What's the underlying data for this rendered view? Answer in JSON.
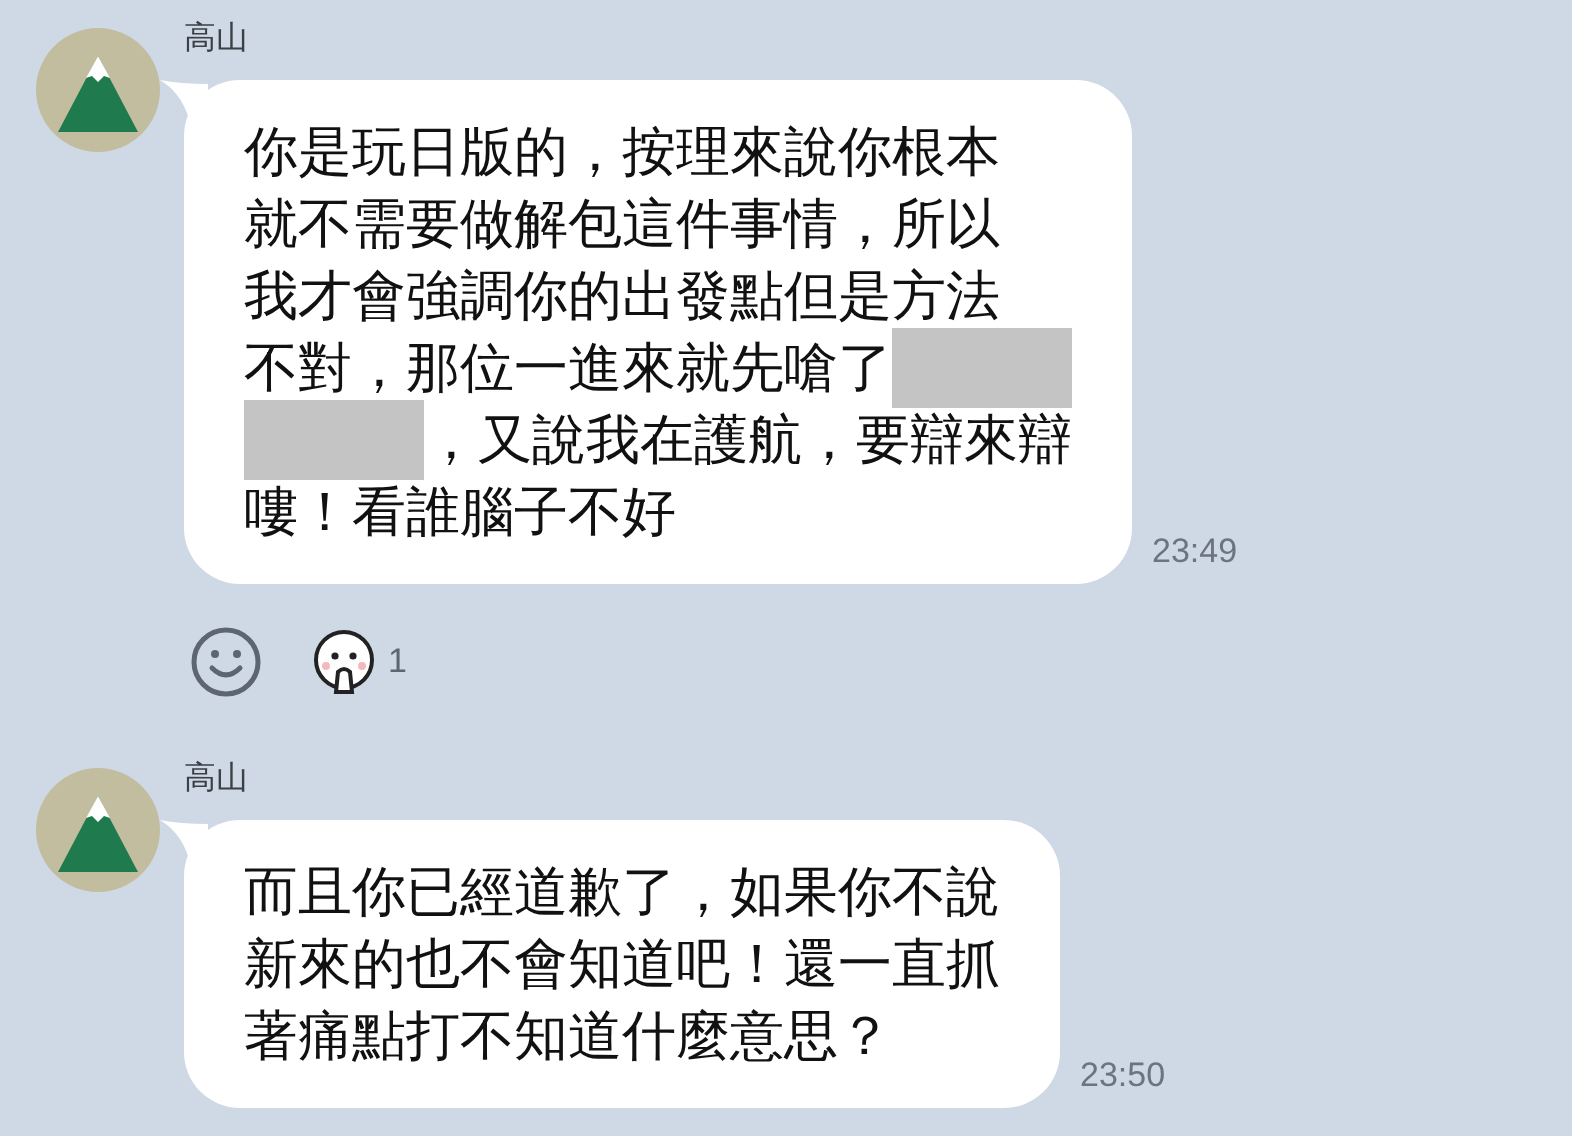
{
  "messages": [
    {
      "sender": "高山",
      "lines": [
        [
          {
            "kind": "text",
            "text": "你是玩日版的，按理來說你根本"
          }
        ],
        [
          {
            "kind": "text",
            "text": "就不需要做解包這件事情，所以"
          }
        ],
        [
          {
            "kind": "text",
            "text": "我才會強調你的出發點但是方法"
          }
        ],
        [
          {
            "kind": "text",
            "text": "不對，那位一進來就先嗆了"
          },
          {
            "kind": "redaction"
          }
        ],
        [
          {
            "kind": "redaction"
          },
          {
            "kind": "text",
            "text": "，又說我在護航，要辯來辯"
          }
        ],
        [
          {
            "kind": "text",
            "text": "嘍！看誰腦子不好"
          }
        ]
      ],
      "time": "23:49",
      "reactions": [
        {
          "count": "1"
        }
      ]
    },
    {
      "sender": "高山",
      "lines": [
        [
          {
            "kind": "text",
            "text": "而且你已經道歉了，如果你不說"
          }
        ],
        [
          {
            "kind": "text",
            "text": "新來的也不會知道吧！還一直抓"
          }
        ],
        [
          {
            "kind": "text",
            "text": "著痛點打不知道什麼意思？"
          }
        ]
      ],
      "time": "23:50"
    }
  ]
}
